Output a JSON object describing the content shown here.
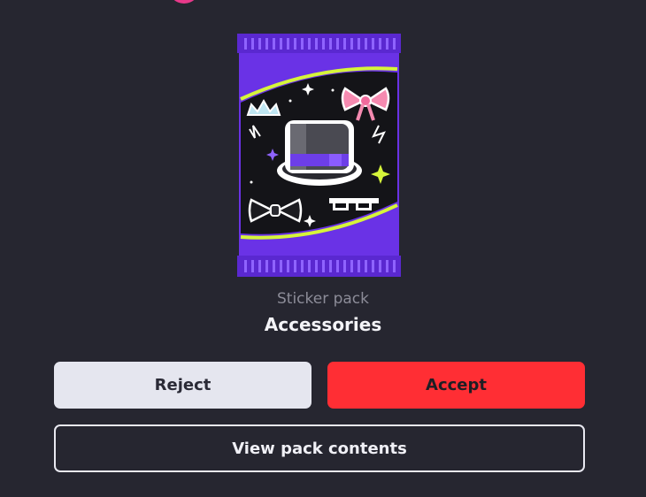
{
  "pack": {
    "type_label": "Sticker pack",
    "name": "Accessories",
    "stickers": [
      "top-hat",
      "bow-tie",
      "hair-bow",
      "tiara",
      "pixel-sunglasses",
      "sparkles"
    ]
  },
  "actions": {
    "reject_label": "Reject",
    "accept_label": "Accept",
    "view_label": "View pack contents"
  },
  "colors": {
    "background": "#262630",
    "accept": "#ff2e34",
    "reject": "#e5e6ef",
    "pack_purple": "#7a3cf0",
    "pack_accent": "#d6f53a"
  }
}
